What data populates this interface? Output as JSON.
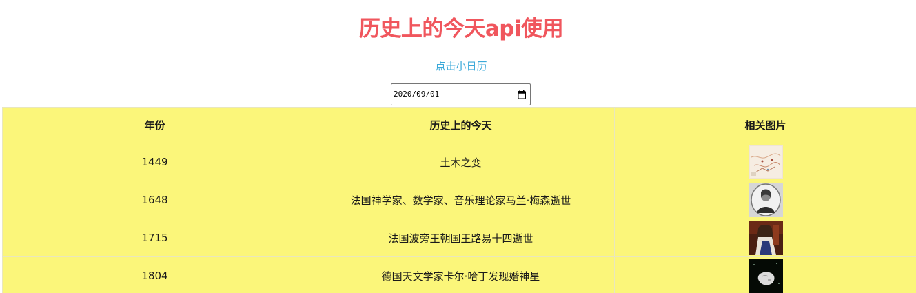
{
  "page": {
    "title": "历史上的今天api使用",
    "calendar_link": "点击小日历"
  },
  "date_picker": {
    "value": "2020/09/01",
    "icon": "calendar-icon"
  },
  "table": {
    "headers": [
      "年份",
      "历史上的今天",
      "相关图片"
    ],
    "rows": [
      {
        "year": "1449",
        "event": "土木之变",
        "image": "map-thumbnail"
      },
      {
        "year": "1648",
        "event": "法国神学家、数学家、音乐理论家马兰·梅森逝世",
        "image": "portrait-thumbnail"
      },
      {
        "year": "1715",
        "event": "法国波旁王朝国王路易十四逝世",
        "image": "painting-thumbnail"
      },
      {
        "year": "1804",
        "event": "德国天文学家卡尔·哈丁发现婚神星",
        "image": "asteroid-thumbnail"
      }
    ]
  },
  "colors": {
    "title": "#f0565d",
    "link": "#3aa9d9",
    "table_bg": "#fbf67a"
  }
}
